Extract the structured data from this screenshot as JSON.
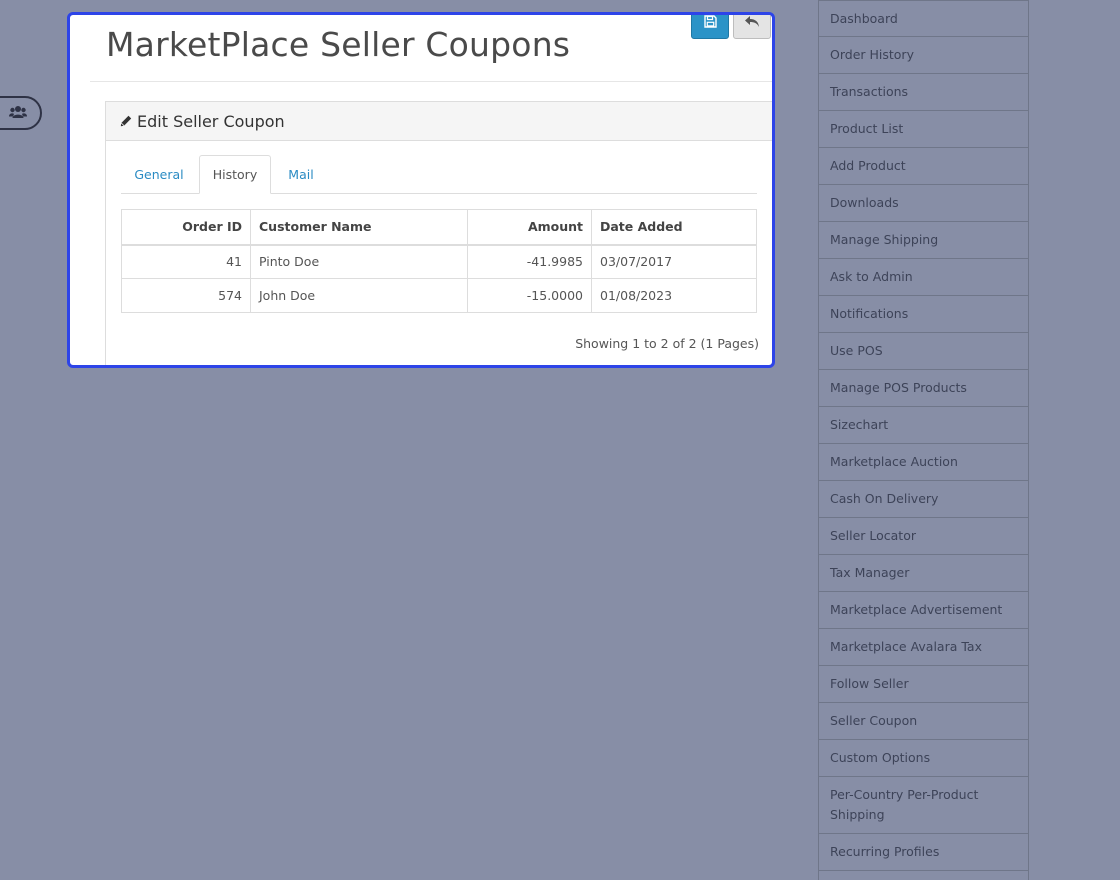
{
  "page": {
    "title": "MarketPlace Seller Coupons"
  },
  "panel": {
    "heading": "Edit Seller Coupon",
    "tabs": [
      {
        "label": "General",
        "active": false
      },
      {
        "label": "History",
        "active": true
      },
      {
        "label": "Mail",
        "active": false
      }
    ]
  },
  "history_table": {
    "headers": [
      "Order ID",
      "Customer Name",
      "Amount",
      "Date Added"
    ],
    "rows": [
      [
        "41",
        "Pinto Doe",
        "-41.9985",
        "03/07/2017"
      ],
      [
        "574",
        "John Doe",
        "-15.0000",
        "01/08/2023"
      ]
    ],
    "pagination": "Showing 1 to 2 of 2 (1 Pages)"
  },
  "toolbar": {
    "save_icon": "floppy-disk-icon",
    "back_icon": "reply-arrow-icon"
  },
  "sidebar": {
    "items": [
      "Dashboard",
      "Order History",
      "Transactions",
      "Product List",
      "Add Product",
      "Downloads",
      "Manage Shipping",
      "Ask to Admin",
      "Notifications",
      "Use POS",
      "Manage POS Products",
      "Sizechart",
      "Marketplace Auction",
      "Cash On Delivery",
      "Seller Locator",
      "Tax Manager",
      "Marketplace Advertisement",
      "Marketplace Avalara Tax",
      "Follow Seller",
      "Seller Coupon",
      "Custom Options",
      "Per-Country Per-Product Shipping",
      "Recurring Profiles"
    ]
  },
  "colors": {
    "background_overlay": "#878ea6",
    "popup_border": "#2d44e8",
    "primary_button": "#2b93c7",
    "link": "#2a8bc3"
  }
}
